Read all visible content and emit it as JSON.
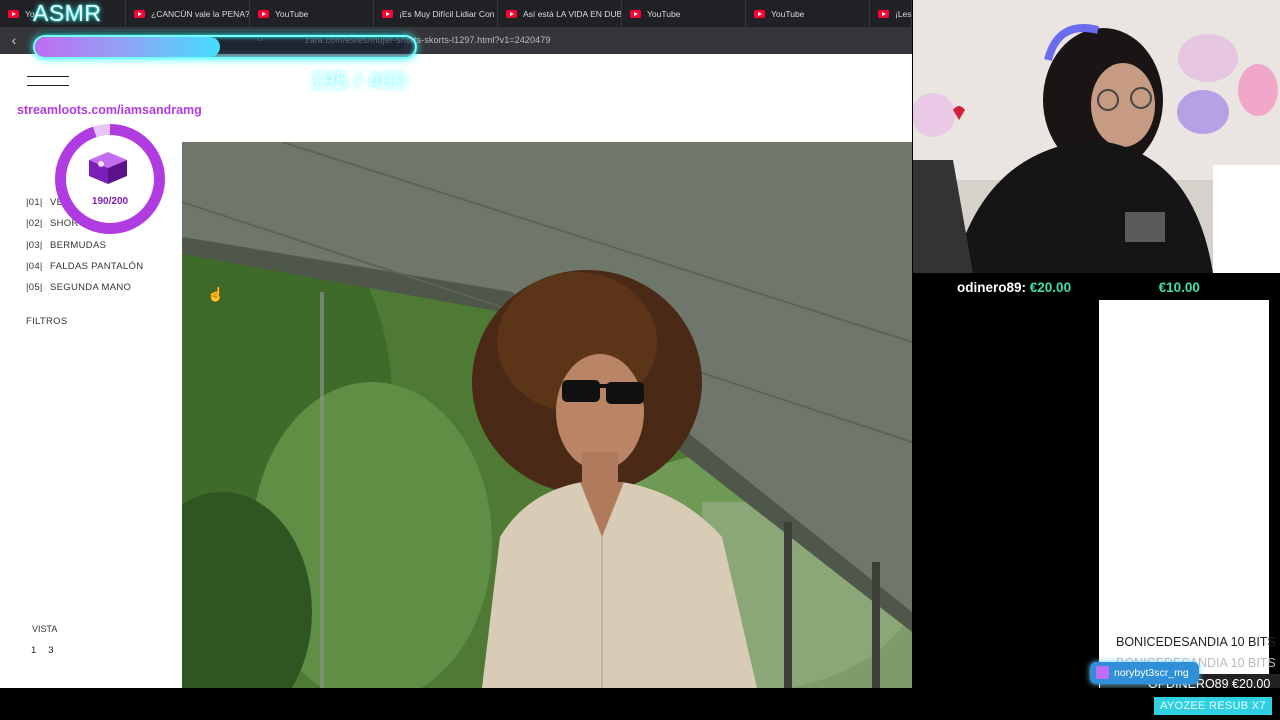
{
  "browser": {
    "tabs": [
      {
        "label": "Yo",
        "icon": "youtube-icon"
      },
      {
        "label": "¿CANCÚN vale la PENA? |",
        "icon": "youtube-icon"
      },
      {
        "label": "YouTube",
        "icon": "youtube-icon"
      },
      {
        "label": "¡Es Muy Difícil Lidiar Con",
        "icon": "youtube-icon"
      },
      {
        "label": "Así está LA VIDA EN DUB",
        "icon": "youtube-icon"
      },
      {
        "label": "YouTube",
        "icon": "youtube-icon"
      },
      {
        "label": "YouTube",
        "icon": "youtube-icon"
      },
      {
        "label": "¡Les C",
        "icon": "youtube-icon"
      }
    ],
    "url": "zara.com/es/es/mujer-shorts-skorts-l1297.html?v1=2420479"
  },
  "page": {
    "streamloots": "streamloots.com/iamsandramg",
    "categories": [
      {
        "num": "|01|",
        "label": "VER TODO"
      },
      {
        "num": "|02|",
        "label": "SHORTS"
      },
      {
        "num": "|03|",
        "label": "BERMUDAS"
      },
      {
        "num": "|04|",
        "label": "FALDAS PANTALÓN"
      },
      {
        "num": "|05|",
        "label": "SEGUNDA MANO"
      }
    ],
    "filters_label": "FILTROS",
    "view_label": "VISTA",
    "view_options": [
      "1",
      "3"
    ]
  },
  "overlay": {
    "asmr_title": "ASMR",
    "goal_current": 195,
    "goal_total": 400,
    "goal_text": "195 / 400",
    "loot_text": "190/200",
    "loot_current": 190,
    "loot_total": 200,
    "accent": "#b03be0",
    "glow": "#33ffff"
  },
  "ticker": [
    {
      "name": "odinero89:",
      "amount": "€20.00"
    },
    {
      "name": "",
      "amount": "€10.00"
    }
  ],
  "events": {
    "list": [
      {
        "text": "BONICEDESANDIA  10 BITS",
        "style": "normal"
      },
      {
        "text": "BONICEDESANDIA  10 BITS",
        "style": "faded"
      },
      {
        "text": "OPDINERO89  €20.00",
        "style": "top"
      }
    ],
    "sub_badge": "norybyt3scr_mg",
    "resub": "AYOZEE  RESUB X7"
  }
}
